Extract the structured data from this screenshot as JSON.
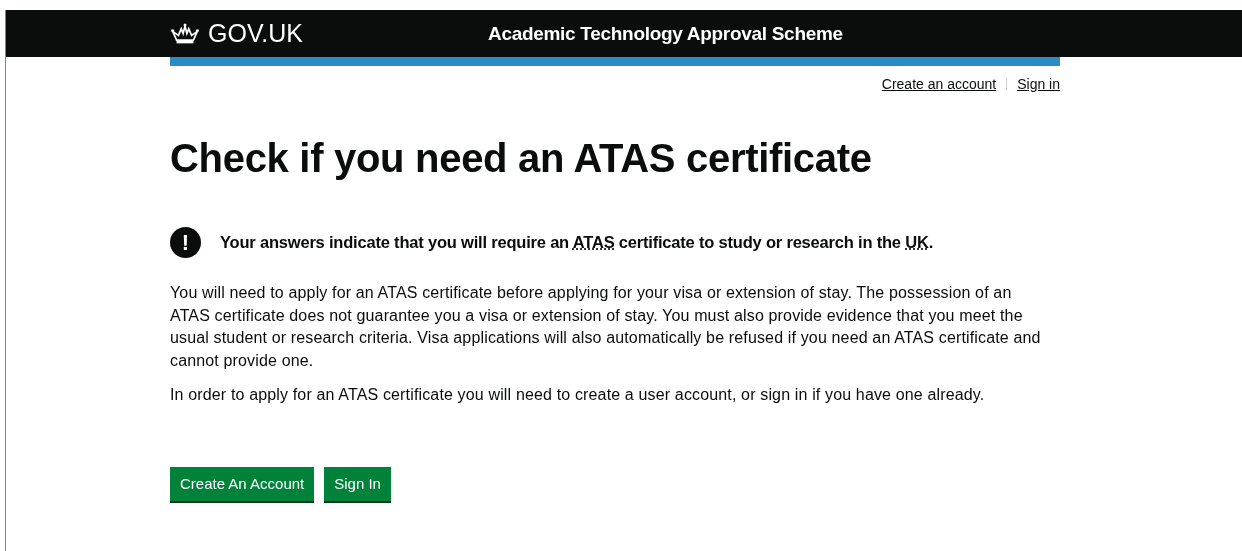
{
  "header": {
    "logo": "GOV.UK",
    "service_name": "Academic Technology Approval Scheme"
  },
  "account_links": [
    {
      "label": "Create an account"
    },
    {
      "label": "Sign in"
    }
  ],
  "heading": "Check if you need an ATAS certificate",
  "warning": {
    "icon": "!",
    "parts": [
      {
        "kind": "text",
        "text": "Your answers indicate that you will require an "
      },
      {
        "kind": "abbr",
        "text": "ATAS"
      },
      {
        "kind": "text",
        "text": " certificate to study or research in the "
      },
      {
        "kind": "abbr",
        "text": "UK"
      },
      {
        "kind": "text",
        "text": "."
      }
    ]
  },
  "paragraphs": [
    "You will need to apply for an ATAS certificate before applying for your visa or extension of stay. The possession of an ATAS certificate does not guarantee you a visa or extension of stay. You must also provide evidence that you meet the usual student or research criteria. Visa applications will also automatically be refused if you need an ATAS certificate and cannot provide one.",
    "In order to apply for an ATAS certificate you will need to create a user account, or sign in if you have one already."
  ],
  "buttons": [
    {
      "label": "Create An Account"
    },
    {
      "label": "Sign In"
    }
  ]
}
